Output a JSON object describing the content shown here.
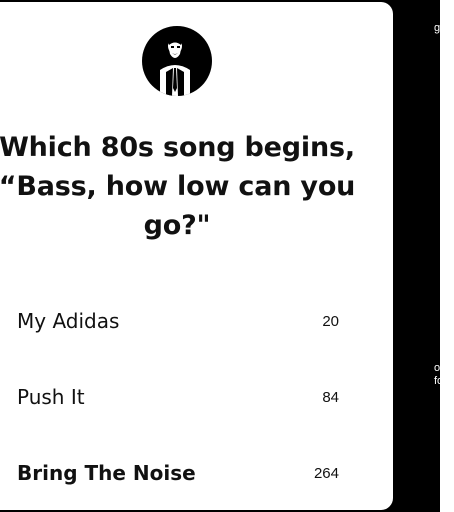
{
  "poll": {
    "question": "Which 80s song begins, “Bass, how low can you go?\"",
    "avatar_icon": "person-avatar-icon",
    "answers": [
      {
        "label": "My Adidas",
        "count": "20"
      },
      {
        "label": "Push It",
        "count": "84"
      },
      {
        "label": "Bring The Noise",
        "count": "264"
      }
    ]
  },
  "side": {
    "fragment_top": "g",
    "fragment_mid": "o",
    "fragment_bottom": "for"
  },
  "colors": {
    "background": "#000000",
    "card": "#ffffff",
    "text": "#111111"
  }
}
